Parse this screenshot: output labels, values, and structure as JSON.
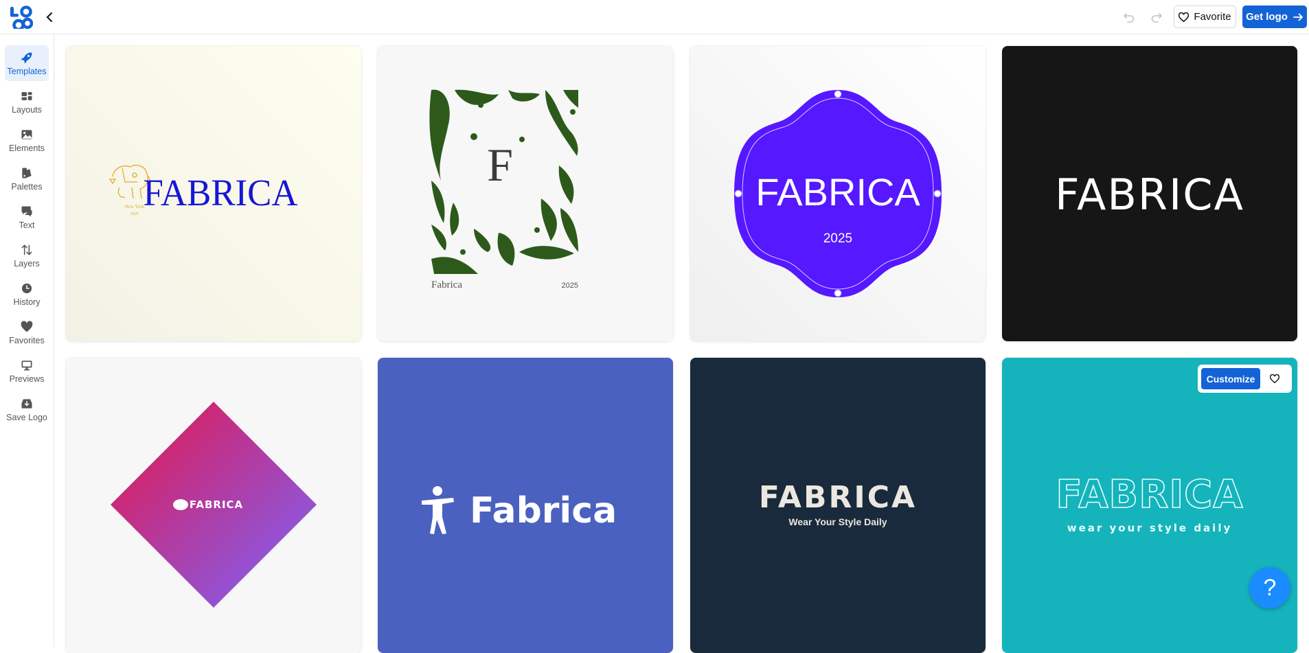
{
  "header": {
    "logo_text": "LOGO",
    "favorite_label": "Favorite",
    "get_logo_label": "Get logo"
  },
  "sidebar": {
    "items": [
      {
        "label": "Templates",
        "icon": "rocket-icon",
        "active": true
      },
      {
        "label": "Layouts",
        "icon": "layouts-icon"
      },
      {
        "label": "Elements",
        "icon": "image-icon"
      },
      {
        "label": "Palettes",
        "icon": "palette-icon"
      },
      {
        "label": "Text",
        "icon": "chat-icon"
      },
      {
        "label": "Layers",
        "icon": "sort-arrows-icon"
      },
      {
        "label": "History",
        "icon": "clock-icon"
      },
      {
        "label": "Favorites",
        "icon": "heart-icon"
      },
      {
        "label": "Previews",
        "icon": "monitor-icon"
      },
      {
        "label": "Save Logo",
        "icon": "download-box-icon"
      }
    ]
  },
  "templates": [
    {
      "brand": "FABRICA",
      "sub_city": "New York",
      "sub_year": "2025",
      "bg": "#fbfbee"
    },
    {
      "letter": "F",
      "brand": "Fabrica",
      "year": "2025",
      "bg": "#f7f7f7",
      "accent": "#2d5a1a"
    },
    {
      "brand": "FABRICA",
      "year": "2025",
      "bg": "#f5f5f5",
      "accent": "#5518ff"
    },
    {
      "brand": "FABRICA",
      "bg": "#161616"
    },
    {
      "brand": "FABRICA",
      "bg": "#f7f7f7"
    },
    {
      "brand": "Fabrica",
      "bg": "#4a61c0"
    },
    {
      "brand": "FABRICA",
      "tagline": "Wear Your Style Daily",
      "bg": "#182a3c"
    },
    {
      "brand": "FABRICA",
      "tagline": "wear your style daily",
      "bg": "#15b3bc"
    }
  ],
  "card_overlay": {
    "customize_label": "Customize"
  },
  "help": {
    "label": "?"
  }
}
